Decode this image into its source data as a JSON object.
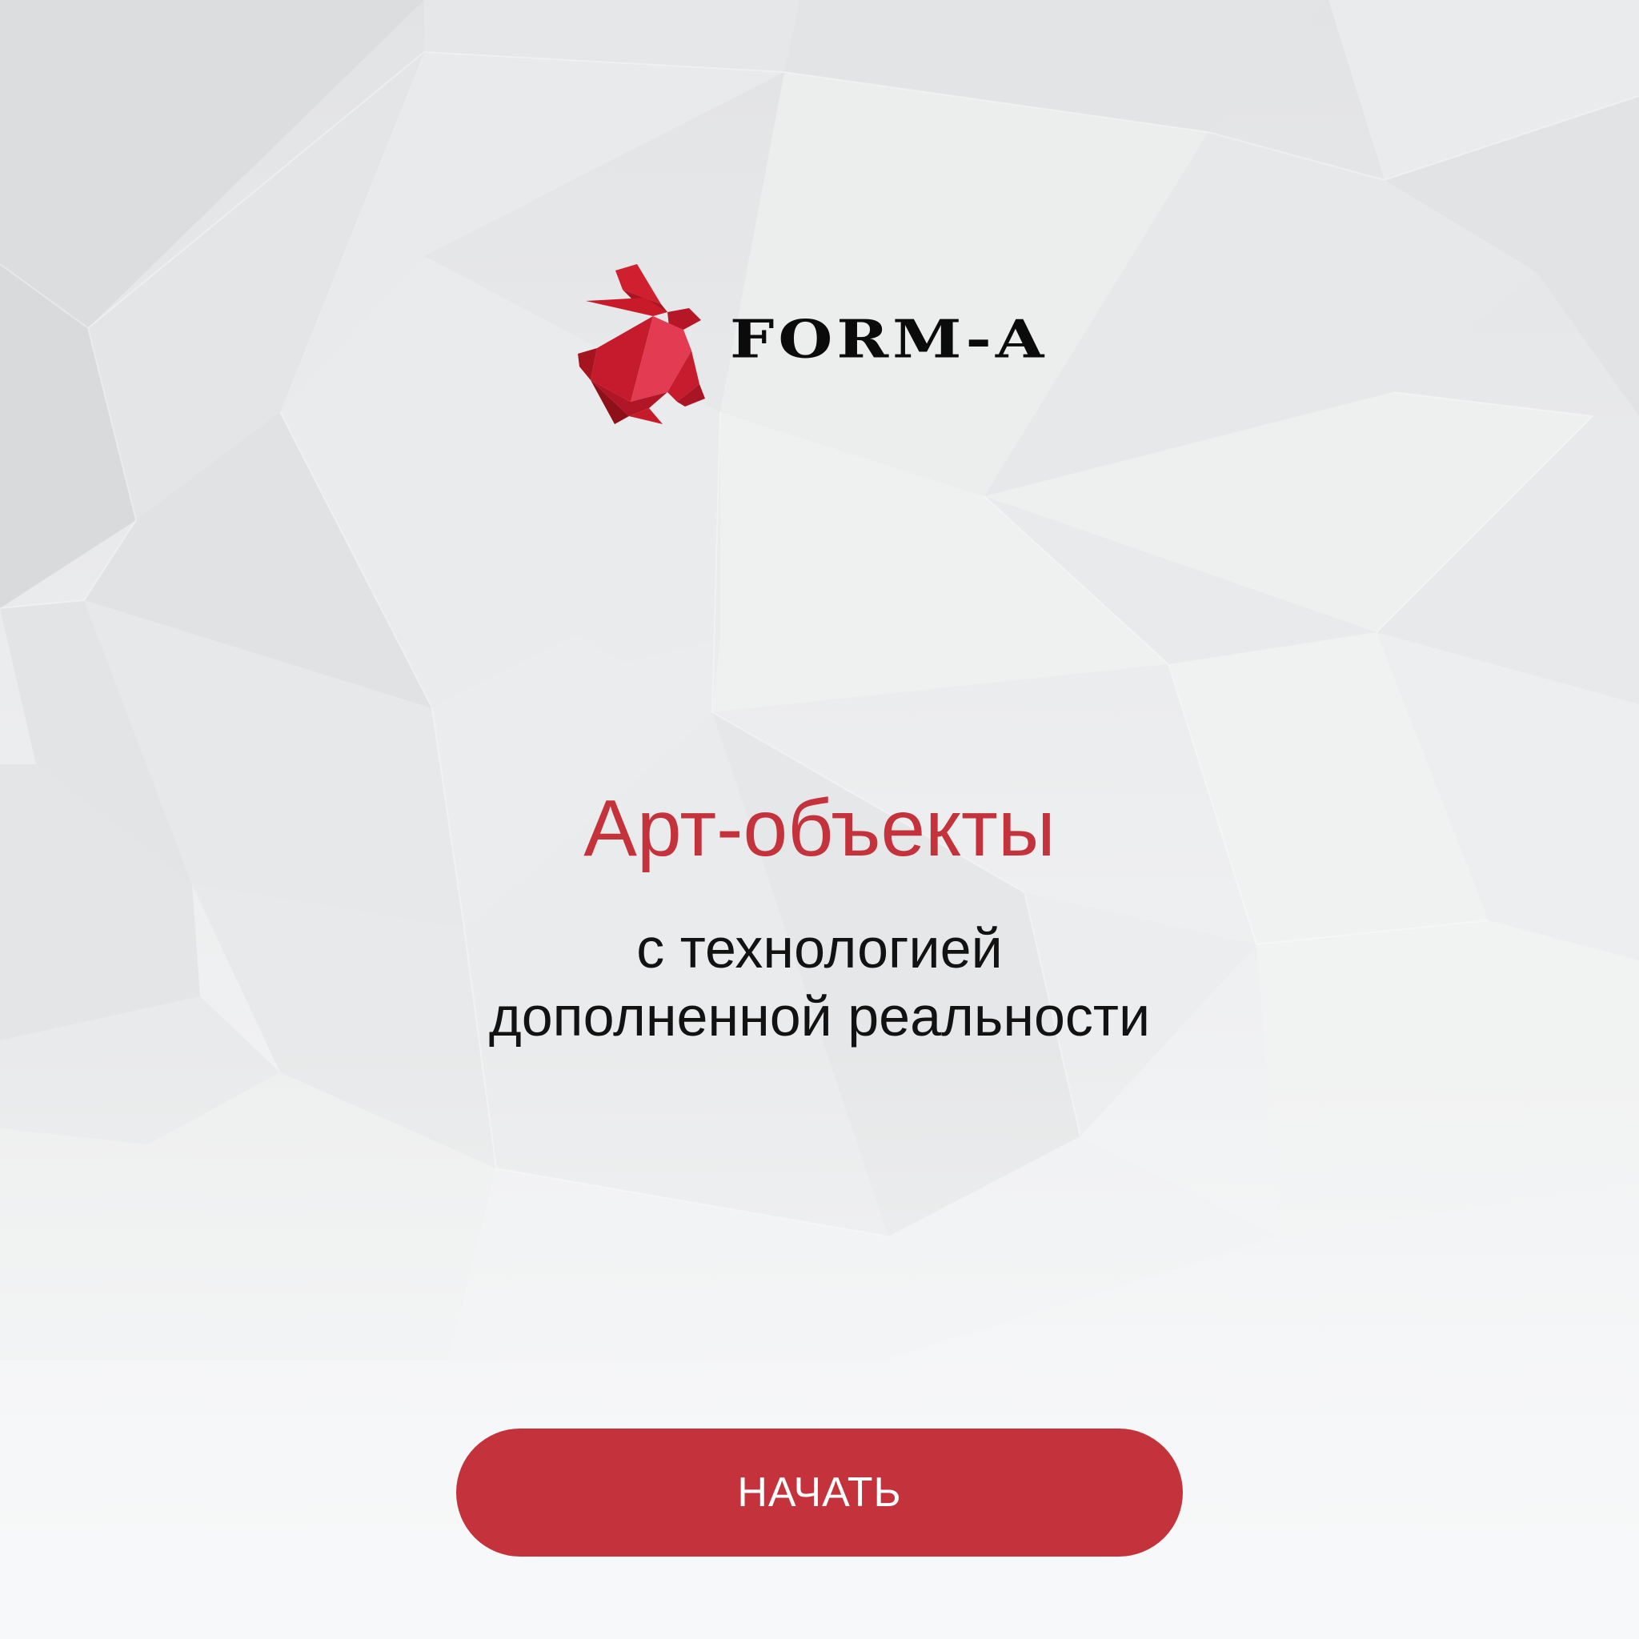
{
  "brand": {
    "name": "FORM-A",
    "logo_icon": "origami-rabbit-icon",
    "accent_color": "#c4323c"
  },
  "hero": {
    "title": "Арт-объекты",
    "subtitle_line1": "с технологией",
    "subtitle_line2": "дополненной реальности"
  },
  "actions": {
    "start_label": "НАЧАТЬ"
  }
}
